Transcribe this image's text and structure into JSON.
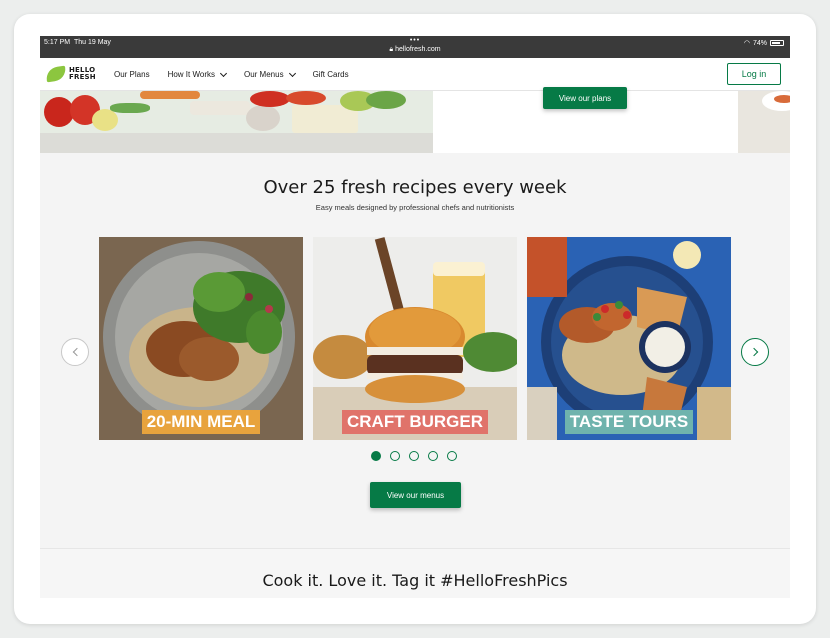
{
  "status_bar": {
    "time": "5:17 PM",
    "date": "Thu 19 May",
    "url": "hellofresh.com",
    "battery": "74%",
    "dots": "•••"
  },
  "nav": {
    "logo_line1": "HELLO",
    "logo_line2": "FRESH",
    "links": [
      "Our Plans",
      "How It Works",
      "Our Menus",
      "Gift Cards"
    ],
    "login_label": "Log in"
  },
  "hero": {
    "plans_button": "View our plans"
  },
  "recipes": {
    "title": "Over 25 fresh recipes every week",
    "subtitle": "Easy meals designed by professional chefs and nutritionists",
    "cards": [
      {
        "label": "20-MIN MEAL",
        "label_color": "#e8a33d"
      },
      {
        "label": "CRAFT BURGER",
        "label_color": "#e0736a"
      },
      {
        "label": "TASTE TOURS",
        "label_color": "#6fb3ad"
      }
    ],
    "carousel_pages": 5,
    "active_page": 1,
    "menus_button": "View our menus"
  },
  "bottom": {
    "title": "Cook it. Love it. Tag it #HelloFreshPics"
  },
  "colors": {
    "brand_green": "#067a46",
    "logo_green": "#8cc63f",
    "section_bg": "#f4f4f4"
  }
}
